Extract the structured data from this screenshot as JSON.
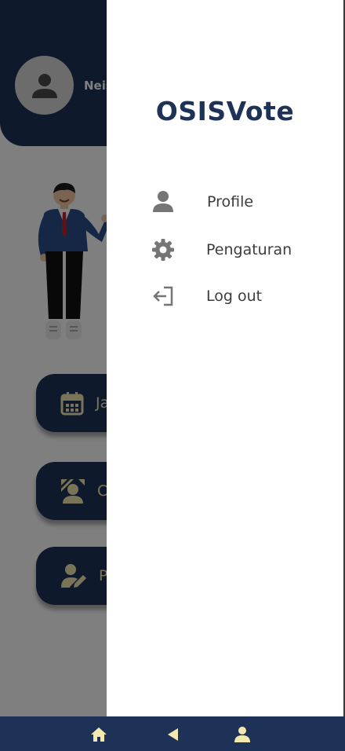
{
  "app": {
    "user_name": "Neisya",
    "buttons": [
      {
        "label": "Jadwal"
      },
      {
        "label": "Calon"
      },
      {
        "label": "Pilih"
      }
    ]
  },
  "drawer": {
    "title": "OSISVote",
    "items": [
      {
        "label": "Profile",
        "icon": "person-icon"
      },
      {
        "label": "Pengaturan",
        "icon": "gear-icon"
      },
      {
        "label": "Log out",
        "icon": "logout-icon"
      }
    ]
  },
  "bottom_nav": {
    "items": [
      "home-icon",
      "back-icon",
      "profile-icon"
    ]
  },
  "colors": {
    "primary": "#1e3258",
    "accent": "#f3e9b0",
    "scrim": "rgba(0,0,0,0.5)"
  }
}
